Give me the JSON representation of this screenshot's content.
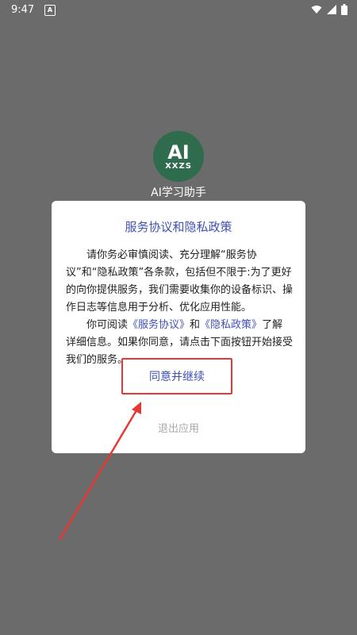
{
  "status_bar": {
    "time": "9:47",
    "app_indicator": "A"
  },
  "app": {
    "logo_big": "AI",
    "logo_small": "XXZS",
    "name": "AI学习助手"
  },
  "dialog": {
    "title": "服务协议和隐私政策",
    "para1": "请你务必审慎阅读、充分理解“服务协议”和“隐私政策”各条款，包括但不限于:为了更好的向你提供服务，我们需要收集你的设备标识、操作日志等信息用于分析、优化应用性能。",
    "para2_prefix": "你可阅读",
    "link_service": "《服务协议》",
    "para2_and": "和",
    "link_privacy": "《隐私政策》",
    "para2_suffix": "了解详细信息。如果你同意，请点击下面按钮开始接受我们的服务。",
    "agree_label": "同意并继续",
    "exit_label": "退出应用"
  },
  "colors": {
    "accent": "#3f51b5",
    "annotation": "#e53935",
    "backdrop": "#6b6b6b"
  },
  "icons": [
    "wifi-icon",
    "signal-icon",
    "battery-icon"
  ]
}
